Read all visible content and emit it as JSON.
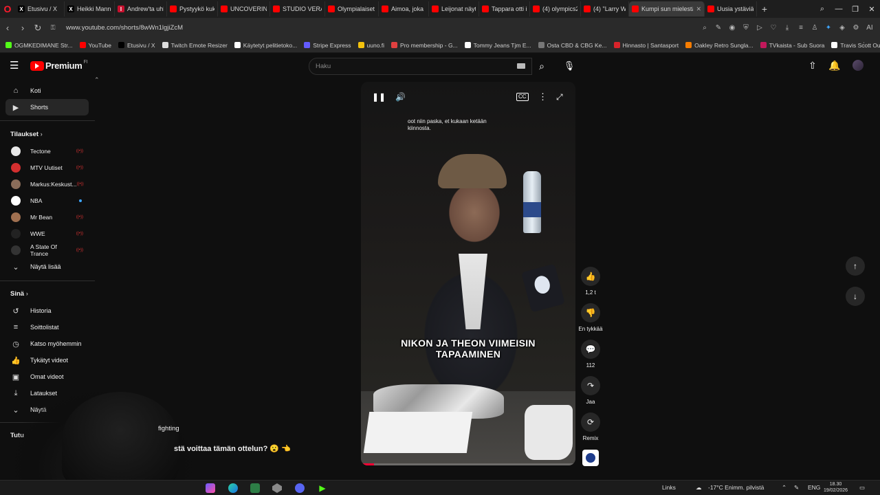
{
  "browser": {
    "tabs": [
      {
        "label": "Etusivu / X",
        "fav": "X",
        "color": "#000000"
      },
      {
        "label": "Heikki Mannon",
        "fav": "X",
        "color": "#000000"
      },
      {
        "label": "Andrew'ta uhk",
        "fav": "I",
        "color": "#c8102e"
      },
      {
        "label": "Pystyykö kuka",
        "fav": "",
        "color": "#ff0000"
      },
      {
        "label": "UNCOVERING T",
        "fav": "",
        "color": "#ff0000"
      },
      {
        "label": "STUDIO VERAZ",
        "fav": "",
        "color": "#ff0000"
      },
      {
        "label": "Olympialaiset",
        "fav": "",
        "color": "#ff0000"
      },
      {
        "label": "Aimoa, joka kas",
        "fav": "",
        "color": "#ff0000"
      },
      {
        "label": "Leijonat näytti",
        "fav": "",
        "color": "#ff0000"
      },
      {
        "label": "Tappara otti inj",
        "fav": "",
        "color": "#ff0000"
      },
      {
        "label": "(4) olympics20",
        "fav": "",
        "color": "#ff0000"
      },
      {
        "label": "(4) \"Larry Whe",
        "fav": "",
        "color": "#ff0000"
      },
      {
        "label": "Kumpi sun mielestä",
        "fav": "",
        "color": "#ff0000",
        "active": true
      },
      {
        "label": "Uusia ystäviä a",
        "fav": "",
        "color": "#ff0000"
      }
    ],
    "url": "www.youtube.com/shorts/8wWn1lgjiZcM",
    "bookmarks": [
      {
        "label": "OGMKEDIMANE Str...",
        "color": "#53fc18"
      },
      {
        "label": "YouTube",
        "color": "#ff0000"
      },
      {
        "label": "Etusivu / X",
        "color": "#000000"
      },
      {
        "label": "Twitch Emote Resizer",
        "color": "#dddddd"
      },
      {
        "label": "Käytetyt pelitietoko...",
        "color": "#ffffff"
      },
      {
        "label": "Stripe Express",
        "color": "#635bff"
      },
      {
        "label": "uuno.fi",
        "color": "#f4c20d"
      },
      {
        "label": "Pro membership - G...",
        "color": "#e04040"
      },
      {
        "label": "Tommy Jeans Tjm E...",
        "color": "#ffffff"
      },
      {
        "label": "Osta CBD & CBG Ke...",
        "color": "#777777"
      },
      {
        "label": "Hinnasto | Santasport",
        "color": "#d8232a"
      },
      {
        "label": "Oakley Retro Sungla...",
        "color": "#f57c00"
      },
      {
        "label": "TVkaista - Sub Suora",
        "color": "#c2185b"
      },
      {
        "label": "Travis Scott Outfits...",
        "color": "#ffffff"
      }
    ]
  },
  "youtube": {
    "logo_text": "Premium",
    "logo_sup": "FI",
    "search_placeholder": "Haku",
    "sidebar": {
      "main": [
        {
          "label": "Koti",
          "icon": "home-icon",
          "glyph": "⌂"
        },
        {
          "label": "Shorts",
          "icon": "shorts-icon",
          "glyph": "▶",
          "active": true
        }
      ],
      "subscriptions_title": "Tilaukset",
      "subscriptions": [
        {
          "label": "Tectone",
          "color": "#e8e8e8",
          "badge": "live"
        },
        {
          "label": "MTV Uutiset",
          "color": "#d32f2f",
          "badge": "live"
        },
        {
          "label": "Markus:Keskust...",
          "color": "#8a6d5a",
          "badge": "live"
        },
        {
          "label": "NBA",
          "color": "#ffffff",
          "badge": "dot"
        },
        {
          "label": "Mr Bean",
          "color": "#a07050",
          "badge": "live"
        },
        {
          "label": "WWE",
          "color": "#222222",
          "badge": "live"
        },
        {
          "label": "A State Of Trance",
          "color": "#333333",
          "badge": "live"
        }
      ],
      "show_more": "Näytä lisää",
      "you_title": "Sinä",
      "you": [
        {
          "label": "Historia",
          "icon": "history-icon",
          "glyph": "↺"
        },
        {
          "label": "Soittolistat",
          "icon": "playlists-icon",
          "glyph": "≡"
        },
        {
          "label": "Katso myöhemmin",
          "icon": "watch-later-icon",
          "glyph": "◷"
        },
        {
          "label": "Tykätyt videot",
          "icon": "liked-icon",
          "glyph": "👍"
        },
        {
          "label": "Omat videot",
          "icon": "your-videos-icon",
          "glyph": "▣"
        },
        {
          "label": "Lataukset",
          "icon": "downloads-icon",
          "glyph": "⤓"
        },
        {
          "label": "Näytä",
          "icon": "chevron-down-icon",
          "glyph": "⌄"
        }
      ],
      "explore_title": "Tutu"
    },
    "short": {
      "caption_top": "oot niin paska, et kukaan ketään kiinnosta.",
      "caption_main": "NIKON JA THEON VIIMEISIN TAPAAMINEN",
      "progress": 0.06,
      "actions": [
        {
          "name": "like-button",
          "glyph": "👍",
          "label": "1,2 t"
        },
        {
          "name": "dislike-button",
          "glyph": "👎",
          "label": "En tykkää"
        },
        {
          "name": "comments-button",
          "glyph": "💬",
          "label": "112"
        },
        {
          "name": "share-button",
          "glyph": "↷",
          "label": "Jaa"
        },
        {
          "name": "remix-button",
          "glyph": "⟳",
          "label": "Remix"
        }
      ]
    },
    "overlay_text_1": "fighting",
    "overlay_text_2": "stä voittaa tämän ottelun? 😮 👈"
  },
  "taskbar": {
    "links": "Links",
    "weather": "-17°C  Enimm. pilvistä",
    "lang": "ENG",
    "time": "18.30",
    "date": "19/02/2026"
  }
}
